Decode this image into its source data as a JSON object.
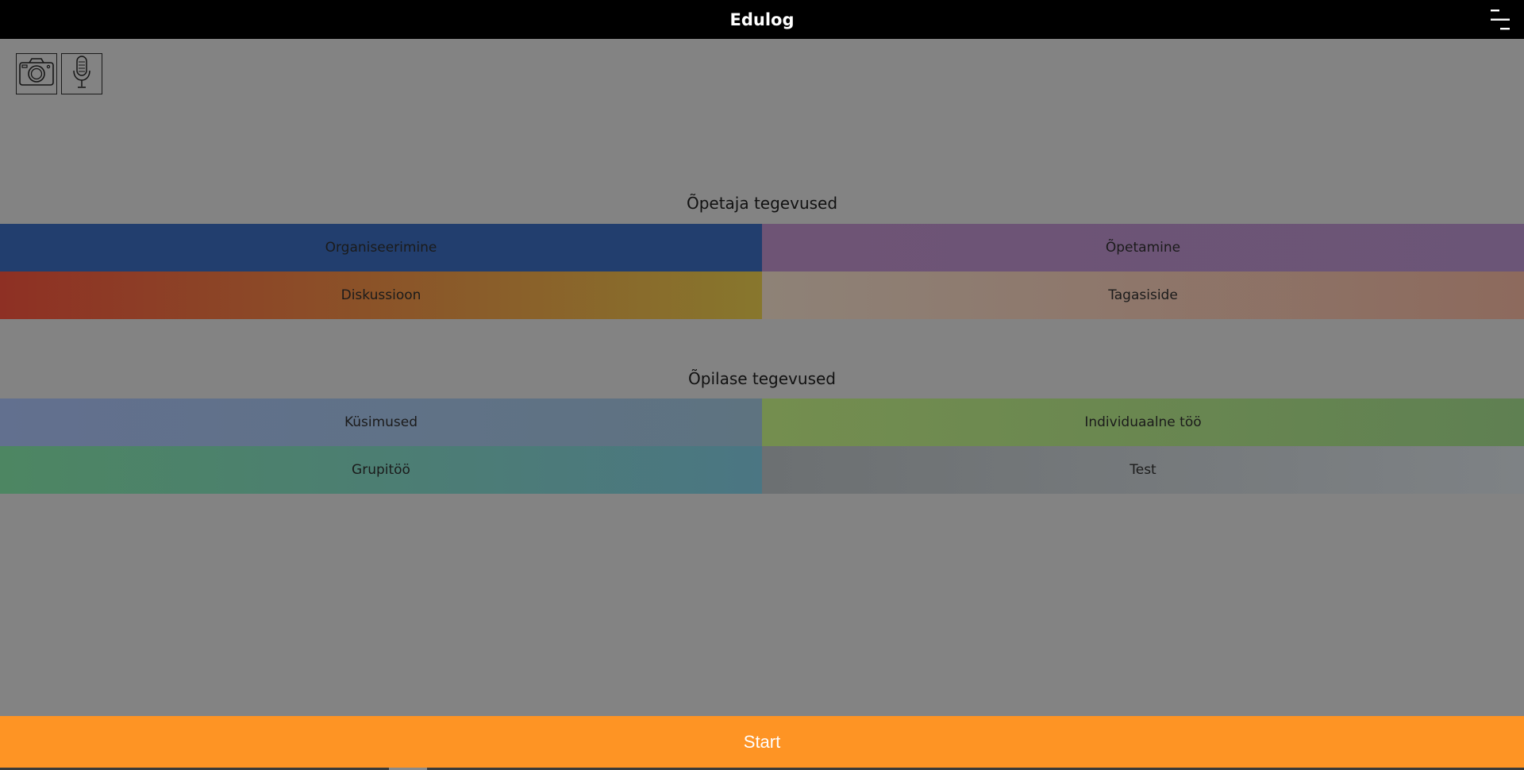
{
  "header": {
    "title": "Edulog",
    "menu_icon": "hamburger-menu-icon"
  },
  "toolbar": {
    "camera_icon": "camera-icon",
    "mic_icon": "microphone-icon"
  },
  "teacher": {
    "title": "Õpetaja tegevused",
    "items": [
      {
        "label": "Organiseerimine",
        "colors": [
          "#223e6e",
          "#223e6e"
        ]
      },
      {
        "label": "Õpetamine",
        "colors": [
          "#6e5475",
          "#6b5577"
        ]
      },
      {
        "label": "Diskussioon",
        "colors": [
          "#8e3024",
          "#88772d"
        ]
      },
      {
        "label": "Tagasiside",
        "colors": [
          "#8e8277",
          "#8d6a5d"
        ]
      }
    ]
  },
  "student": {
    "title": "Õpilase tegevused",
    "items": [
      {
        "label": "Küsimused",
        "colors": [
          "#62708f",
          "#5e7380"
        ]
      },
      {
        "label": "Individuaalne töö",
        "colors": [
          "#748e4f",
          "#5f8052"
        ]
      },
      {
        "label": "Grupitöö",
        "colors": [
          "#4d8662",
          "#4b7683"
        ]
      },
      {
        "label": "Test",
        "colors": [
          "#6c7072",
          "#7e8285"
        ]
      }
    ]
  },
  "footer": {
    "start_label": "Start",
    "accent": "#fe9424"
  }
}
